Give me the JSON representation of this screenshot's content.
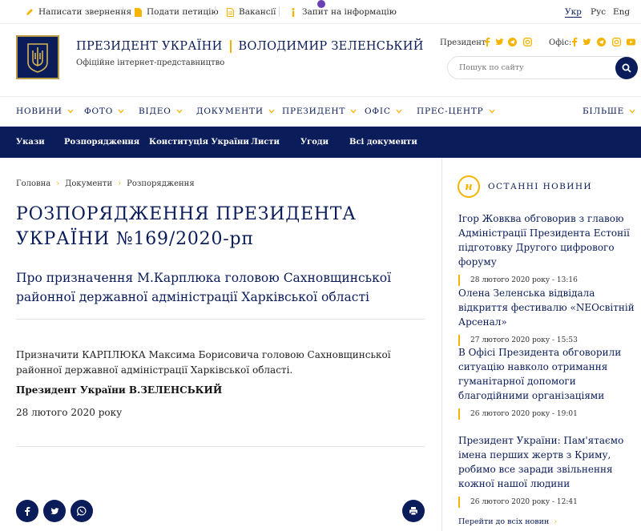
{
  "topbar": {
    "links": [
      {
        "label": "Написати звернення",
        "icon": "pencil-icon"
      },
      {
        "label": "Подати петицію",
        "icon": "document-icon"
      },
      {
        "label": "Вакансії",
        "icon": "file-icon"
      },
      {
        "label": "Запит на інформацію",
        "icon": "info-icon"
      }
    ],
    "languages": [
      "Укр",
      "Рус",
      "Eng"
    ],
    "active_language": "Укр"
  },
  "header": {
    "title_part1": "ПРЕЗИДЕНТ УКРАЇНИ",
    "title_part2": "ВОЛОДИМИР ЗЕЛЕНСЬКИЙ",
    "subtitle": "Офіційне інтернет-представництво",
    "social_president_label": "Президент:",
    "social_office_label": "Офіс:",
    "search_placeholder": "Пошук по сайту"
  },
  "main_nav": {
    "items": [
      "НОВИНИ",
      "ФОТО",
      "ВІДЕО",
      "ДОКУМЕНТИ",
      "ПРЕЗИДЕНТ",
      "ОФІС",
      "ПРЕС-ЦЕНТР"
    ],
    "more": "БІЛЬШЕ"
  },
  "sub_nav": {
    "items": [
      "Укази",
      "Розпорядження",
      "Конституція України",
      "Листи",
      "Угоди",
      "Всі документи"
    ]
  },
  "breadcrumb": [
    "Головна",
    "Документи",
    "Розпорядження"
  ],
  "document": {
    "title": "РОЗПОРЯДЖЕННЯ ПРЕЗИДЕНТА УКРАЇНИ №169/2020-рп",
    "subtitle": "Про призначення М.Карплюка головою Сахновщинської районної державної адміністрації Харківської області",
    "body": "Призначити КАРПЛЮКА Максима Борисовича головою Сахновщинської районної державної адміністрації Харківської області.",
    "signature": "Президент України В.ЗЕЛЕНСЬКИЙ",
    "date": "28 лютого 2020 року"
  },
  "sidebar": {
    "heading": "ОСТАННІ НОВИНИ",
    "icon_letter": "н",
    "news": [
      {
        "title": "Ігор Жовква обговорив з главою Адміністрації Президента Естонії підготовку Другого цифрового форуму",
        "time": "28 лютого 2020 року - 13:16"
      },
      {
        "title": "Олена Зеленська відвідала відкриття фестивалю «NEOсвітній Арсенал»",
        "time": "27 лютого 2020 року - 15:53"
      },
      {
        "title": "В Офісі Президента обговорили ситуацію навколо отримання гуманітарної допомоги благодійними організаціями",
        "time": "26 лютого 2020 року - 19:01"
      },
      {
        "title": "Президент України: Пам'ятаємо імена перших жертв з Криму, робимо все заради звільнення кожної нашої людини",
        "time": "26 лютого 2020 року - 12:41"
      }
    ],
    "all_news": "Перейти до всіх новин"
  },
  "colors": {
    "navy": "#0a1c59",
    "gold": "#f5b400"
  }
}
